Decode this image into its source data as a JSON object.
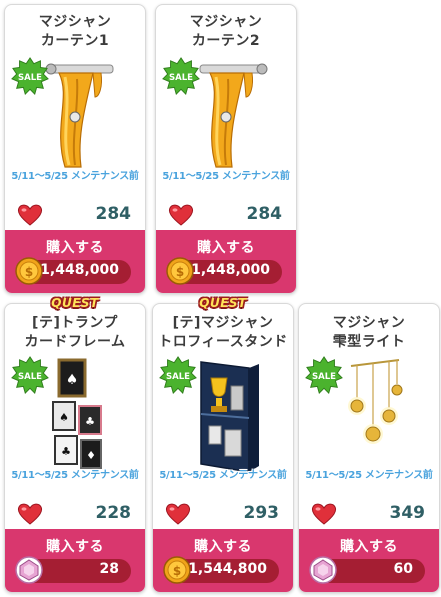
{
  "colors": {
    "accent": "#d9376e",
    "price_bar": "#a51e33",
    "likes_text": "#2f5f65",
    "maintenance_text": "#4aa3dd",
    "heart": "#e0303a",
    "sale_badge": "#4bb32e"
  },
  "cards": [
    {
      "title": "マジシャン\nカーテン1",
      "quest": "",
      "sale": "SALE",
      "maintenance": "5/11～5/25 メンテナンス前",
      "likes": "284",
      "buy_label": "購入する",
      "currency_icon": "coin-icon",
      "price": "1,448,000"
    },
    {
      "title": "マジシャン\nカーテン2",
      "quest": "",
      "sale": "SALE",
      "maintenance": "5/11～5/25 メンテナンス前",
      "likes": "284",
      "buy_label": "購入する",
      "currency_icon": "coin-icon",
      "price": "1,448,000"
    },
    {
      "title": "[テ]トランプ\nカードフレーム",
      "quest": "QUEST",
      "sale": "SALE",
      "maintenance": "5/11～5/25 メンテナンス前",
      "likes": "228",
      "buy_label": "購入する",
      "currency_icon": "gem-icon",
      "price": "28"
    },
    {
      "title": "[テ]マジシャン\nトロフィースタンド",
      "quest": "QUEST",
      "sale": "SALE",
      "maintenance": "5/11～5/25 メンテナンス前",
      "likes": "293",
      "buy_label": "購入する",
      "currency_icon": "coin-icon",
      "price": "1,544,800"
    },
    {
      "title": "マジシャン\n雫型ライト",
      "quest": "",
      "sale": "SALE",
      "maintenance": "5/11～5/25 メンテナンス前",
      "likes": "349",
      "buy_label": "購入する",
      "currency_icon": "gem-icon",
      "price": "60"
    }
  ]
}
